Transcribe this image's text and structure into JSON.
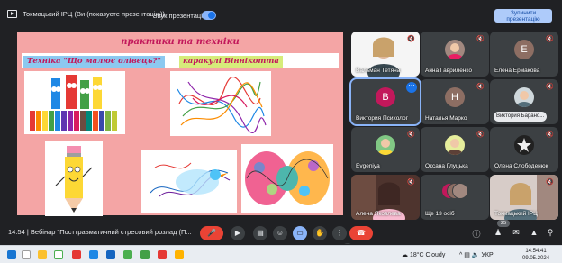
{
  "presenting": {
    "text": "Токмацький ІРЦ (Ви (показуєте презентацію))",
    "sound_label": "Звук презентації",
    "stop_label_line1": "Зупинити",
    "stop_label_line2": "презентацію"
  },
  "slide": {
    "title": "практики та техніки",
    "subtitle_left": "Техніка \"Що малює олівець?\"",
    "subtitle_right": "каракулі Віннікотта"
  },
  "participants": [
    {
      "name": "Вальман Тетяна",
      "muted": true,
      "type": "video"
    },
    {
      "name": "Анна Гавриленко",
      "muted": true,
      "type": "photo"
    },
    {
      "name": "Елена Ермакова",
      "muted": true,
      "type": "letter",
      "letter": "Е",
      "color": "#8d6e63"
    },
    {
      "name": "Виктория Психолог",
      "muted": false,
      "type": "letter",
      "letter": "В",
      "color": "#c2185b"
    },
    {
      "name": "Наталья Марко",
      "muted": true,
      "type": "letter",
      "letter": "Н",
      "color": "#8d6e63"
    },
    {
      "name": "Виктория Барано...",
      "muted": true,
      "type": "photo"
    },
    {
      "name": "Evgeniya",
      "muted": true,
      "type": "photo"
    },
    {
      "name": "Оксана Глуцька",
      "muted": true,
      "type": "photo"
    },
    {
      "name": "Олена Слободенюк",
      "muted": true,
      "type": "photo"
    },
    {
      "name": "Алена Яковлева",
      "muted": true,
      "type": "video"
    },
    {
      "name": "Ще 13 осіб",
      "muted": false,
      "type": "stack"
    },
    {
      "name": "Токмацький ІРЦ",
      "muted": true,
      "type": "video"
    }
  ],
  "callbar": {
    "time": "14:54",
    "meeting_title": "Вебінар \"Посттравматичний стресовий розлад (П...",
    "participant_count": "25"
  },
  "taskbar": {
    "weather": "18°C Cloudy",
    "lang": "УКР",
    "time": "14:54:41",
    "date": "09.05.2024"
  },
  "colors": {
    "call_bg": "#202124",
    "tile_bg": "#3c4043",
    "accent": "#8ab4f8",
    "end_call": "#ea4335",
    "slide_bg": "#f4a5a5"
  }
}
